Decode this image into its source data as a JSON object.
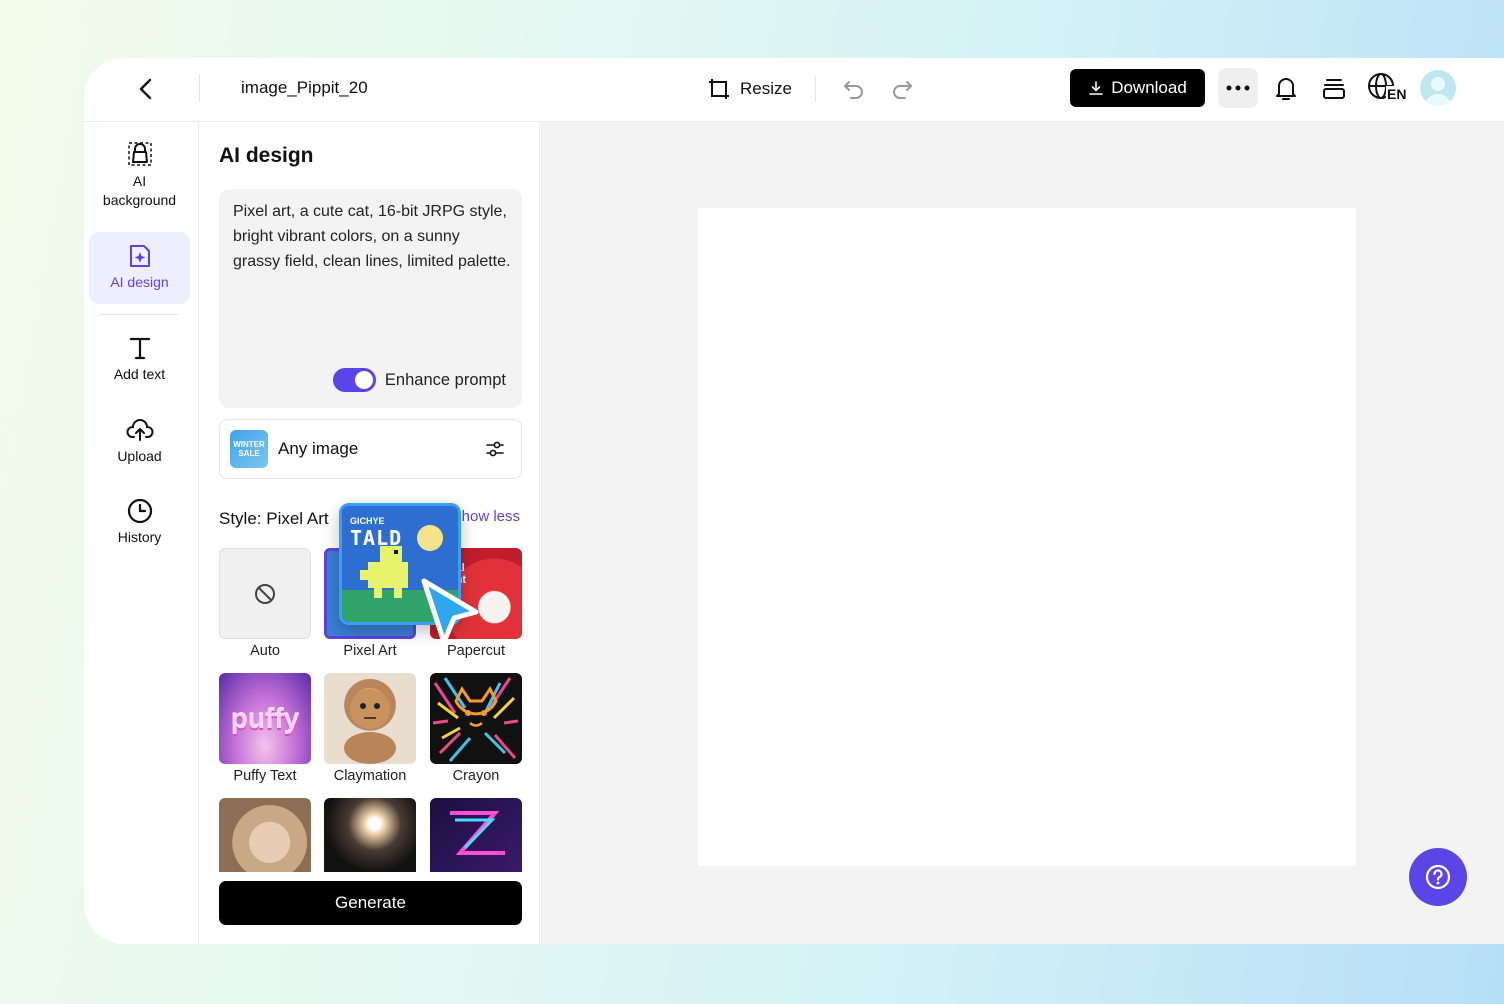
{
  "header": {
    "doc_title": "image_Pippit_20",
    "resize_label": "Resize",
    "download_label": "Download",
    "language": "EN"
  },
  "rail": {
    "items": [
      {
        "label": "AI background",
        "icon": "lock-bag-icon"
      },
      {
        "label": "AI design",
        "icon": "ai-design-icon",
        "active": true
      },
      {
        "label": "Add text",
        "icon": "text-icon"
      },
      {
        "label": "Upload",
        "icon": "cloud-upload-icon"
      },
      {
        "label": "History",
        "icon": "clock-icon"
      }
    ]
  },
  "panel": {
    "title": "AI design",
    "prompt": "Pixel art, a cute cat, 16-bit JRPG style, bright vibrant colors, on a sunny grassy field, clean lines, limited palette.",
    "enhance_label": "Enhance prompt",
    "enhance_on": true,
    "any_image_label": "Any image",
    "any_image_thumb_text": "WINTER SALE",
    "style_label": "Style: Pixel Art",
    "show_less_label": "how less",
    "styles": [
      {
        "label": "Auto"
      },
      {
        "label": "Pixel Art",
        "selected": true
      },
      {
        "label": "Papercut"
      },
      {
        "label": "Puffy Text"
      },
      {
        "label": "Claymation"
      },
      {
        "label": "Crayon"
      }
    ],
    "thumb_texts": {
      "pixel_art": "TALD",
      "pixel_art_small": "GICHYE",
      "papercut": "asonal scount",
      "puffy": "puffy"
    },
    "generate_label": "Generate"
  },
  "colors": {
    "accent": "#5b45e6",
    "primary_button": "#000000",
    "canvas_bg": "#f3f3f3"
  }
}
